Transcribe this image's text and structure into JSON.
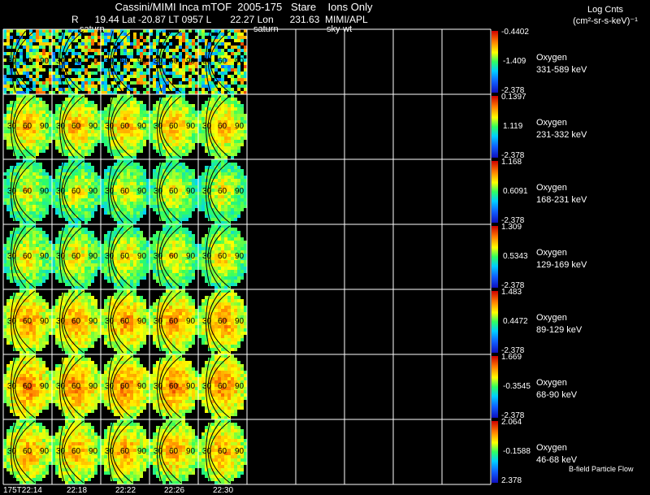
{
  "header": {
    "line1": "Cassini/MIMI Inca mTOF  2005-175   Stare    Ions Only",
    "line2": "R      19.44 Lat -20.87 LT 0957 L       22.27 Lon      231.63  MIMI/APL"
  },
  "overlay_labels": {
    "saturn_a": "saturn",
    "saturn_b": "saturn",
    "sky": "sky-wt"
  },
  "corner": {
    "title": "Log Cnts",
    "units": "(cm²-sr-s-keV)⁻¹"
  },
  "rows": [
    {
      "species": "Oxygen",
      "energy": "331-589 keV",
      "cb_max": "-0.4402",
      "cb_mid": "-1.409",
      "cb_min": "-2.378",
      "level": 0.22
    },
    {
      "species": "Oxygen",
      "energy": "231-332 keV",
      "cb_max": "0.1397",
      "cb_mid": "1.119",
      "cb_min": "-2.378",
      "level": 0.78
    },
    {
      "species": "Oxygen",
      "energy": "168-231 keV",
      "cb_max": "1.168",
      "cb_mid": "0.6091",
      "cb_min": "-2.378",
      "level": 0.7
    },
    {
      "species": "Oxygen",
      "energy": "129-169 keV",
      "cb_max": "1.309",
      "cb_mid": "0.5343",
      "cb_min": "-2.378",
      "level": 0.72
    },
    {
      "species": "Oxygen",
      "energy": "89-129 keV",
      "cb_max": "1.483",
      "cb_mid": "0.4472",
      "cb_min": "-2.378",
      "level": 0.82
    },
    {
      "species": "Oxygen",
      "energy": "68-90 keV",
      "cb_max": "1.669",
      "cb_mid": "-0.3545",
      "cb_min": "-2.378",
      "level": 0.84
    },
    {
      "species": "Oxygen",
      "energy": "46-68 keV",
      "cb_max": "2.064",
      "cb_mid": "-0.1588",
      "cb_min": "2.378",
      "level": 0.8
    }
  ],
  "contour_labels": [
    "30",
    "60",
    "90"
  ],
  "times": [
    "175T22:14",
    "22:18",
    "22:22",
    "22:26",
    "22:30"
  ],
  "footnote": "B-field Particle Flow",
  "colors": {
    "background": "#000000",
    "grid": "#ffffff"
  }
}
